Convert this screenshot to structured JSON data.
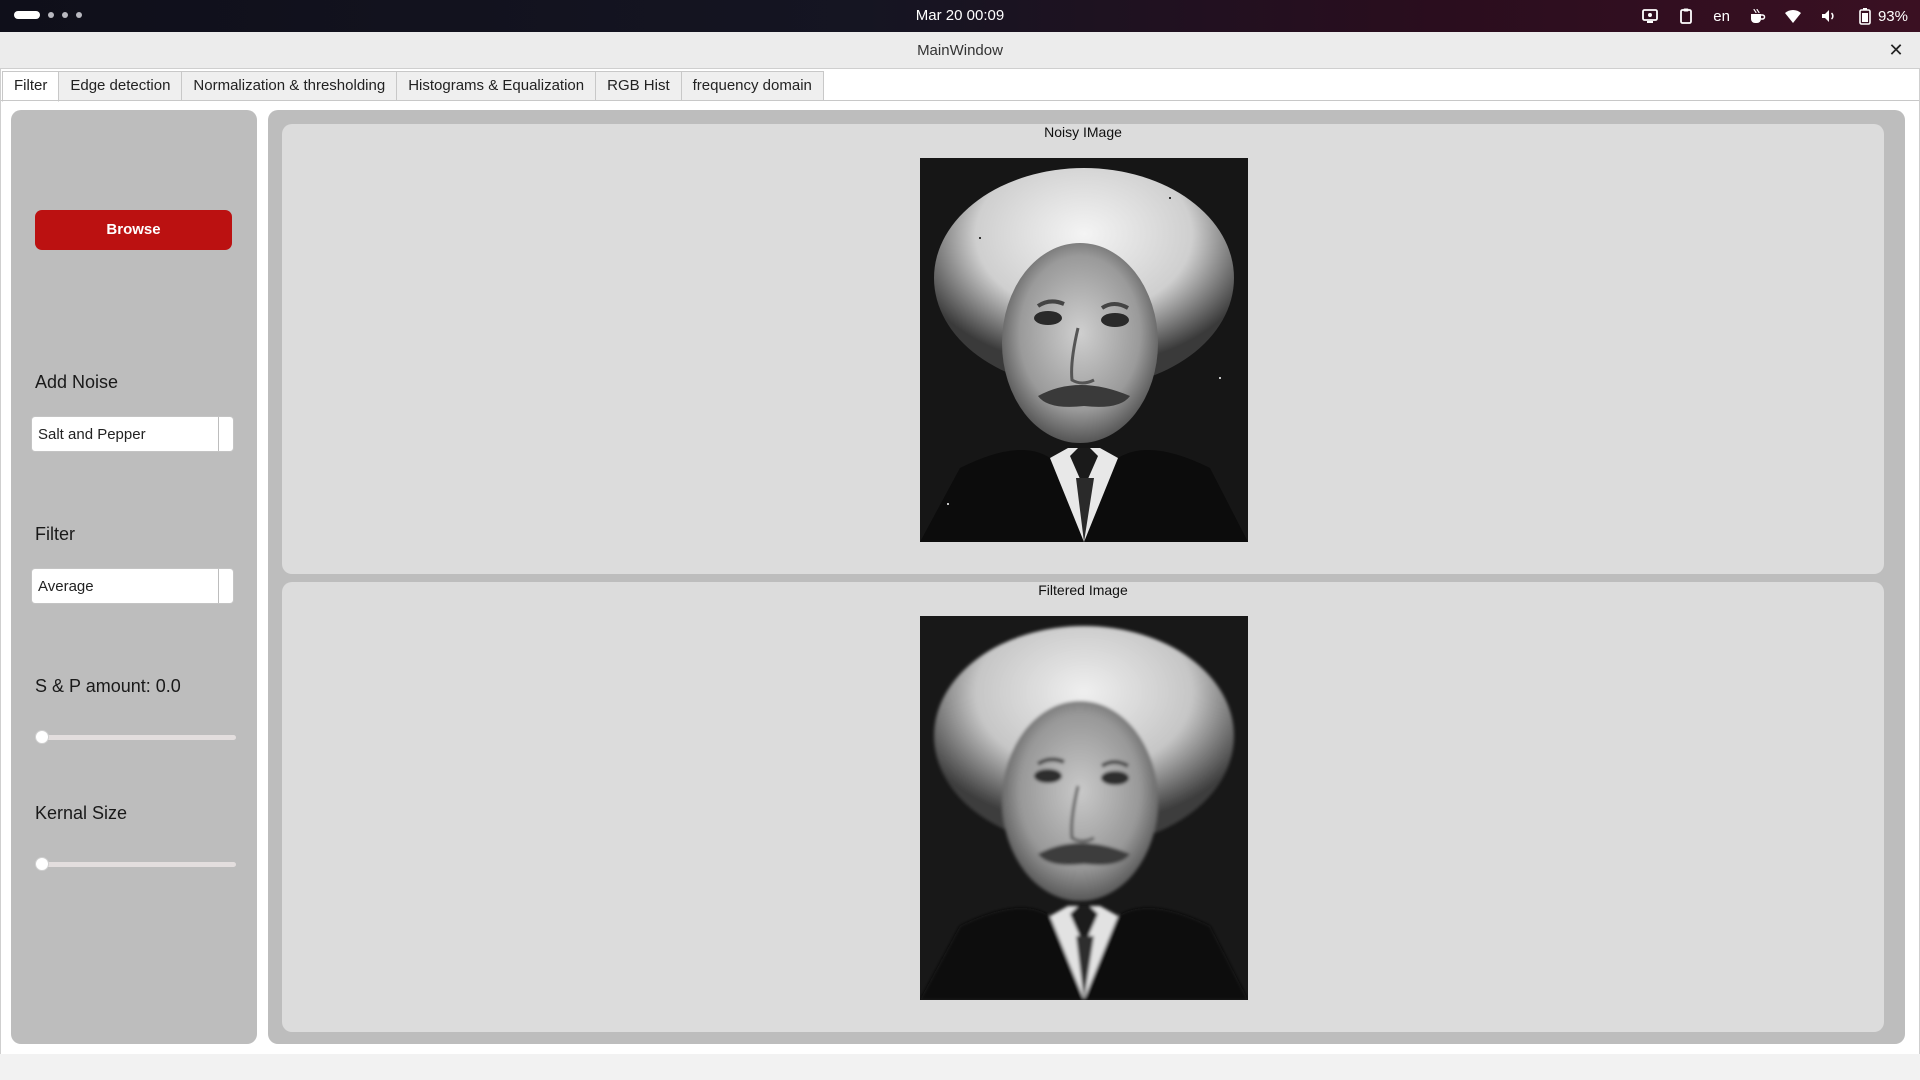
{
  "topbar": {
    "datetime": "Mar 20  00:09",
    "language": "en",
    "battery": "93%",
    "icons": [
      "screen-share-icon",
      "clipboard-icon",
      "coffee-icon",
      "wifi-icon",
      "volume-icon",
      "battery-icon"
    ]
  },
  "window": {
    "title": "MainWindow",
    "close_glyph": "✕"
  },
  "tabs": [
    {
      "label": "Filter",
      "active": true
    },
    {
      "label": "Edge detection"
    },
    {
      "label": "Normalization & thresholding"
    },
    {
      "label": "Histograms & Equalization"
    },
    {
      "label": "RGB Hist"
    },
    {
      "label": "frequency domain"
    }
  ],
  "controls": {
    "browse_label": "Browse",
    "add_noise_label": "Add Noise",
    "noise_value": "Salt and Pepper",
    "filter_label": "Filter",
    "filter_value": "Average",
    "sp_amount_label": "S & P amount: 0.0",
    "sp_amount_level": 0.0,
    "kernel_label": "Kernal Size",
    "kernel_level": 0.0
  },
  "images": {
    "noisy_caption": "Noisy IMage",
    "filtered_caption": "Filtered Image"
  },
  "colors": {
    "accent": "#bb1111",
    "panel": "#bdbdbd",
    "frame": "#dcdcdc"
  }
}
